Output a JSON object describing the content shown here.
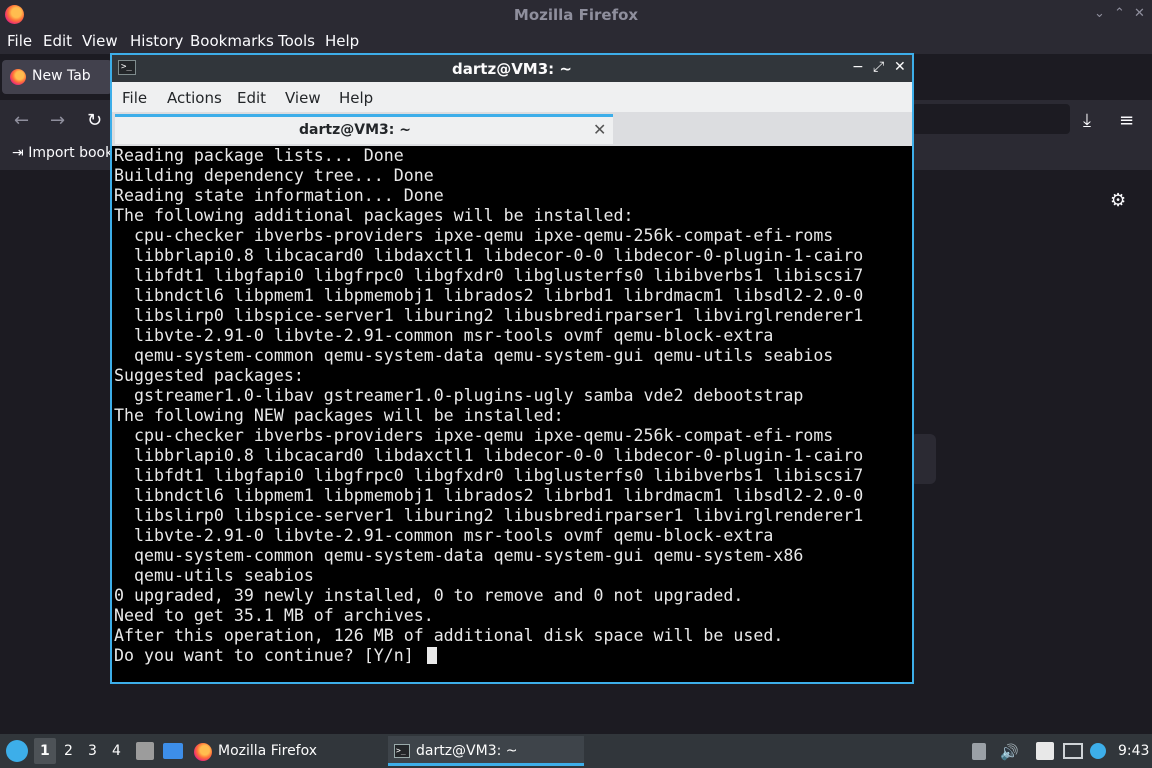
{
  "firefox": {
    "window_title": "Mozilla Firefox",
    "menu": [
      "File",
      "Edit",
      "View",
      "History",
      "Bookmarks",
      "Tools",
      "Help"
    ],
    "tab_label": "New Tab",
    "bookmark_label": "Import book",
    "icons": {
      "back": "←",
      "forward": "→",
      "reload": "↻",
      "download": "⤓",
      "menu": "≡",
      "settings": "⚙",
      "min": "⌄",
      "max": "⌃",
      "close": "✕"
    }
  },
  "terminal": {
    "window_title": "dartz@VM3: ~",
    "menu": [
      "File",
      "Actions",
      "Edit",
      "View",
      "Help"
    ],
    "tab_label": "dartz@VM3: ~",
    "tab_close": "✕",
    "controls": {
      "min": "−",
      "max": "⤢",
      "close": "✕"
    },
    "lines": [
      "Reading package lists... Done",
      "Building dependency tree... Done",
      "Reading state information... Done",
      "The following additional packages will be installed:",
      "  cpu-checker ibverbs-providers ipxe-qemu ipxe-qemu-256k-compat-efi-roms",
      "  libbrlapi0.8 libcacard0 libdaxctl1 libdecor-0-0 libdecor-0-plugin-1-cairo",
      "  libfdt1 libgfapi0 libgfrpc0 libgfxdr0 libglusterfs0 libibverbs1 libiscsi7",
      "  libndctl6 libpmem1 libpmemobj1 librados2 librbd1 librdmacm1 libsdl2-2.0-0",
      "  libslirp0 libspice-server1 liburing2 libusbredirparser1 libvirglrenderer1",
      "  libvte-2.91-0 libvte-2.91-common msr-tools ovmf qemu-block-extra",
      "  qemu-system-common qemu-system-data qemu-system-gui qemu-utils seabios",
      "Suggested packages:",
      "  gstreamer1.0-libav gstreamer1.0-plugins-ugly samba vde2 debootstrap",
      "The following NEW packages will be installed:",
      "  cpu-checker ibverbs-providers ipxe-qemu ipxe-qemu-256k-compat-efi-roms",
      "  libbrlapi0.8 libcacard0 libdaxctl1 libdecor-0-0 libdecor-0-plugin-1-cairo",
      "  libfdt1 libgfapi0 libgfrpc0 libgfxdr0 libglusterfs0 libibverbs1 libiscsi7",
      "  libndctl6 libpmem1 libpmemobj1 librados2 librbd1 librdmacm1 libsdl2-2.0-0",
      "  libslirp0 libspice-server1 liburing2 libusbredirparser1 libvirglrenderer1",
      "  libvte-2.91-0 libvte-2.91-common msr-tools ovmf qemu-block-extra",
      "  qemu-system-common qemu-system-data qemu-system-gui qemu-system-x86",
      "  qemu-utils seabios",
      "0 upgraded, 39 newly installed, 0 to remove and 0 not upgraded.",
      "Need to get 35.1 MB of archives.",
      "After this operation, 126 MB of additional disk space will be used."
    ],
    "prompt": "Do you want to continue? [Y/n] "
  },
  "taskbar": {
    "workspaces": [
      "1",
      "2",
      "3",
      "4"
    ],
    "apps": [
      {
        "label": "Mozilla Firefox"
      },
      {
        "label": "dartz@VM3: ~"
      }
    ],
    "clock": "9:43",
    "tray_icons": [
      "clipboard-icon",
      "volume-icon",
      "notes-icon",
      "network-icon",
      "updates-icon"
    ]
  }
}
